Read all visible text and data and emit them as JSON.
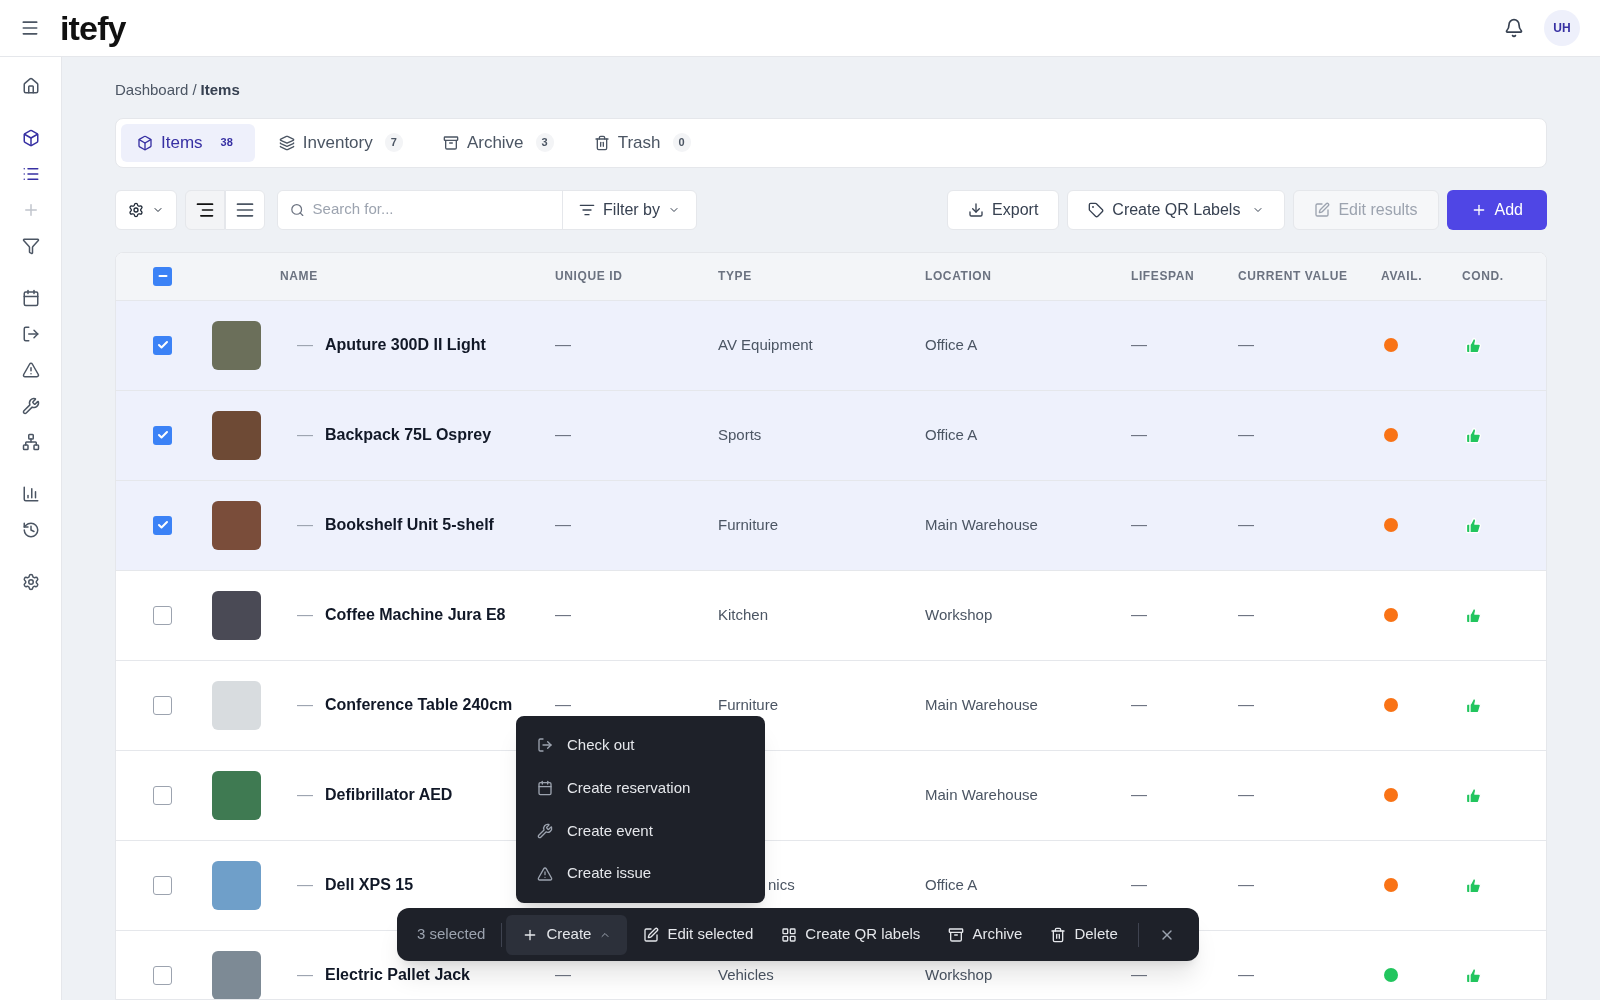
{
  "app": {
    "logo": "itefy",
    "avatar": "UH"
  },
  "sidebar": {
    "items": [
      {
        "kind": "home",
        "selected": false
      },
      {
        "kind": "box",
        "selected": true
      },
      {
        "kind": "list",
        "selected": true
      },
      {
        "kind": "plus",
        "selected": false
      },
      {
        "kind": "filter",
        "selected": false
      },
      {
        "kind": "calendar",
        "selected": false
      },
      {
        "kind": "checkout",
        "selected": false
      },
      {
        "kind": "alert",
        "selected": false
      },
      {
        "kind": "wrench",
        "selected": false
      },
      {
        "kind": "people",
        "selected": false
      },
      {
        "kind": "chart",
        "selected": false
      },
      {
        "kind": "history",
        "selected": false
      },
      {
        "kind": "settings",
        "selected": false
      }
    ]
  },
  "breadcrumb": [
    "Dashboard",
    "/",
    "Items"
  ],
  "tabs": [
    {
      "kind": "box",
      "label": "Items",
      "count": "38",
      "selected": true
    },
    {
      "kind": "layers",
      "label": "Inventory",
      "count": "7",
      "selected": false
    },
    {
      "kind": "archive",
      "label": "Archive",
      "count": "3",
      "selected": false
    },
    {
      "kind": "trash",
      "label": "Trash",
      "count": "0",
      "selected": false
    }
  ],
  "toolbar": {
    "view_modes": [
      {
        "kind": "tree",
        "selected": true
      },
      {
        "kind": "list",
        "selected": false
      }
    ],
    "search": {
      "placeholder": "Search for..."
    },
    "filter": "Filter by",
    "export": "Export",
    "qr": "Create QR Labels",
    "edit": {
      "label": "Edit results",
      "disabled": true
    },
    "add": "Add"
  },
  "table": {
    "select_all_indeterminate": true,
    "columns": [
      "NAME",
      "UNIQUE ID",
      "TYPE",
      "LOCATION",
      "LIFESPAN",
      "CURRENT VALUE",
      "AVAIL.",
      "COND."
    ],
    "rows": [
      {
        "checked": true,
        "prefix": "—",
        "name": "Aputure 300D II Light",
        "unique_id": "—",
        "type": "AV Equipment",
        "location": "Office A",
        "lifespan": "—",
        "current_value": "—",
        "color": "#f97316"
      },
      {
        "checked": true,
        "prefix": "—",
        "name": "Backpack 75L Osprey",
        "unique_id": "—",
        "type": "Sports",
        "location": "Office A",
        "lifespan": "—",
        "current_value": "—",
        "color": "#f97316"
      },
      {
        "checked": true,
        "prefix": "—",
        "name": "Bookshelf Unit 5-shelf",
        "unique_id": "—",
        "type": "Furniture",
        "location": "Main Warehouse",
        "lifespan": "—",
        "current_value": "—",
        "color": "#f97316"
      },
      {
        "checked": false,
        "prefix": "—",
        "name": "Coffee Machine Jura E8",
        "unique_id": "—",
        "type": "Kitchen",
        "location": "Workshop",
        "lifespan": "—",
        "current_value": "—",
        "color": "#f97316"
      },
      {
        "checked": false,
        "prefix": "—",
        "name": "Conference Table 240cm",
        "unique_id": "—",
        "type": "Furniture",
        "location": "Main Warehouse",
        "lifespan": "—",
        "current_value": "—",
        "color": "#f97316"
      },
      {
        "checked": false,
        "prefix": "—",
        "name": "Defibrillator AED",
        "location": "Main Warehouse",
        "lifespan": "—",
        "current_value": "—",
        "color": "#f97316"
      },
      {
        "checked": false,
        "prefix": "—",
        "name": "Dell XPS 15",
        "type": "nics",
        "type_cut": true,
        "location": "Office A",
        "lifespan": "—",
        "current_value": "—",
        "color": "#f97316"
      },
      {
        "checked": false,
        "prefix": "—",
        "name": "Electric Pallet Jack",
        "unique_id": "—",
        "type": "Vehicles",
        "location": "Workshop",
        "lifespan": "—",
        "current_value": "—",
        "color": "#22c55e"
      }
    ]
  },
  "create_menu": {
    "items": [
      {
        "kind": "checkout",
        "label": "Check out"
      },
      {
        "kind": "calendar",
        "label": "Create reservation"
      },
      {
        "kind": "wrench",
        "label": "Create event"
      },
      {
        "kind": "alert",
        "label": "Create issue"
      }
    ]
  },
  "bulk_bar": {
    "count": "3 selected",
    "create": {
      "label": "Create",
      "expanded": true
    },
    "actions": [
      {
        "kind": "edit",
        "label": "Edit selected"
      },
      {
        "kind": "qr",
        "label": "Create QR labels"
      },
      {
        "kind": "archive",
        "label": "Archive"
      },
      {
        "kind": "trash",
        "label": "Delete"
      }
    ]
  }
}
